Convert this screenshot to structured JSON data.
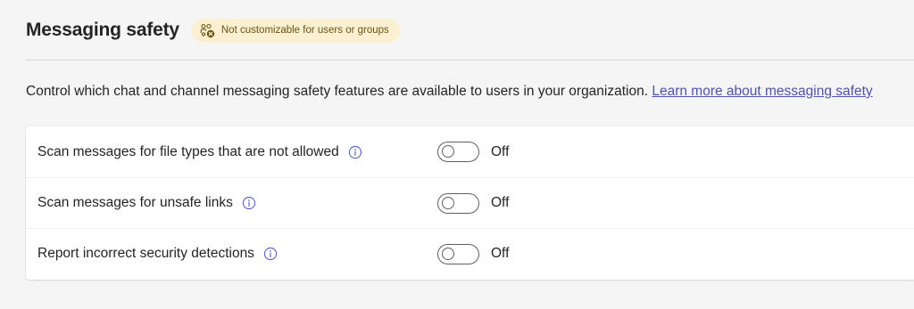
{
  "section": {
    "title": "Messaging safety",
    "badge_text": "Not customizable for users or groups",
    "badge_icon": "people-blocked-icon",
    "description": "Control which chat and channel messaging safety features are available to users in your organization.",
    "learn_more_link": "Learn more about messaging safety"
  },
  "settings": [
    {
      "label": "Scan messages for file types that are not allowed",
      "state": "Off",
      "enabled": false
    },
    {
      "label": "Scan messages for unsafe links",
      "state": "Off",
      "enabled": false
    },
    {
      "label": "Report incorrect security detections",
      "state": "Off",
      "enabled": false
    }
  ],
  "colors": {
    "badge_background": "#fbf0d1",
    "link": "#4f52b2",
    "info_icon": "#5b5fc7"
  }
}
